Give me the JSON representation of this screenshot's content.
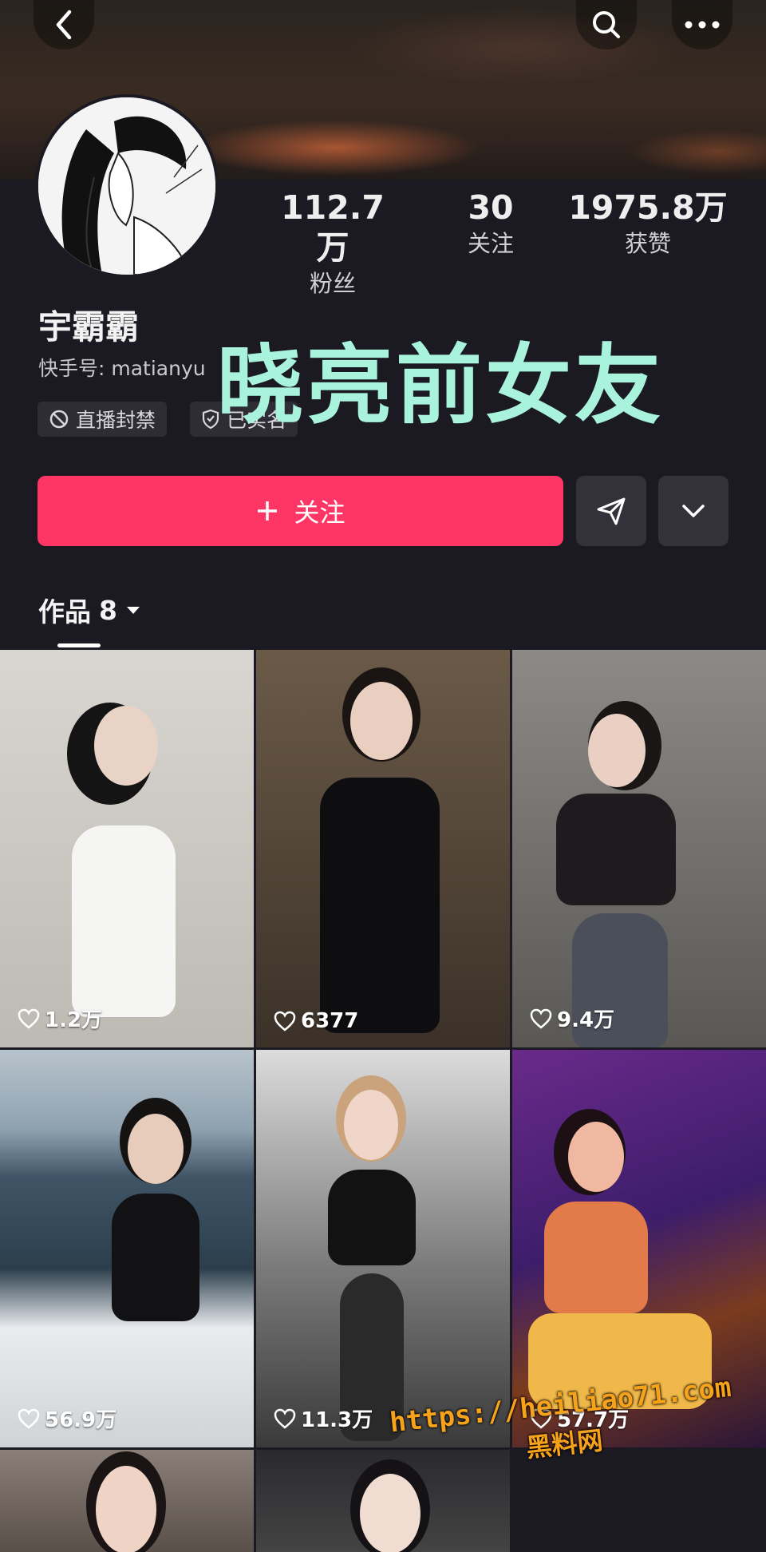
{
  "profile": {
    "name": "宇霸霸",
    "kuaishou_id": "快手号: matianyu",
    "tags": [
      "直播封禁",
      "已实名"
    ],
    "stats": [
      {
        "value": "112.7万",
        "label": "粉丝"
      },
      {
        "value": "30",
        "label": "关注"
      },
      {
        "value": "1975.8万",
        "label": "获赞"
      }
    ]
  },
  "overlay_title": "晓亮前女友",
  "actions": {
    "follow_label": "关注"
  },
  "tabs": {
    "works_label": "作品",
    "works_count": "8"
  },
  "videos": [
    {
      "likes": "1.2万"
    },
    {
      "likes": "6377"
    },
    {
      "likes": "9.4万"
    },
    {
      "likes": "56.9万"
    },
    {
      "likes": "11.3万"
    },
    {
      "likes": "57.7万"
    }
  ],
  "watermark": {
    "url": "https://heiliao71.com",
    "site": "黑料网"
  },
  "icons": {
    "back": "chevron-left-icon",
    "search": "search-icon",
    "more": "more-dots-icon",
    "ban": "ban-icon",
    "verified": "shield-check-icon",
    "plus": "plus-icon",
    "share": "send-icon",
    "dropdown": "chevron-down-icon",
    "heart": "heart-icon"
  },
  "colors": {
    "accent": "#fe3666",
    "background": "#1b1a22",
    "overlay_text": "#a9f3dc",
    "watermark": "#f7a21b"
  }
}
